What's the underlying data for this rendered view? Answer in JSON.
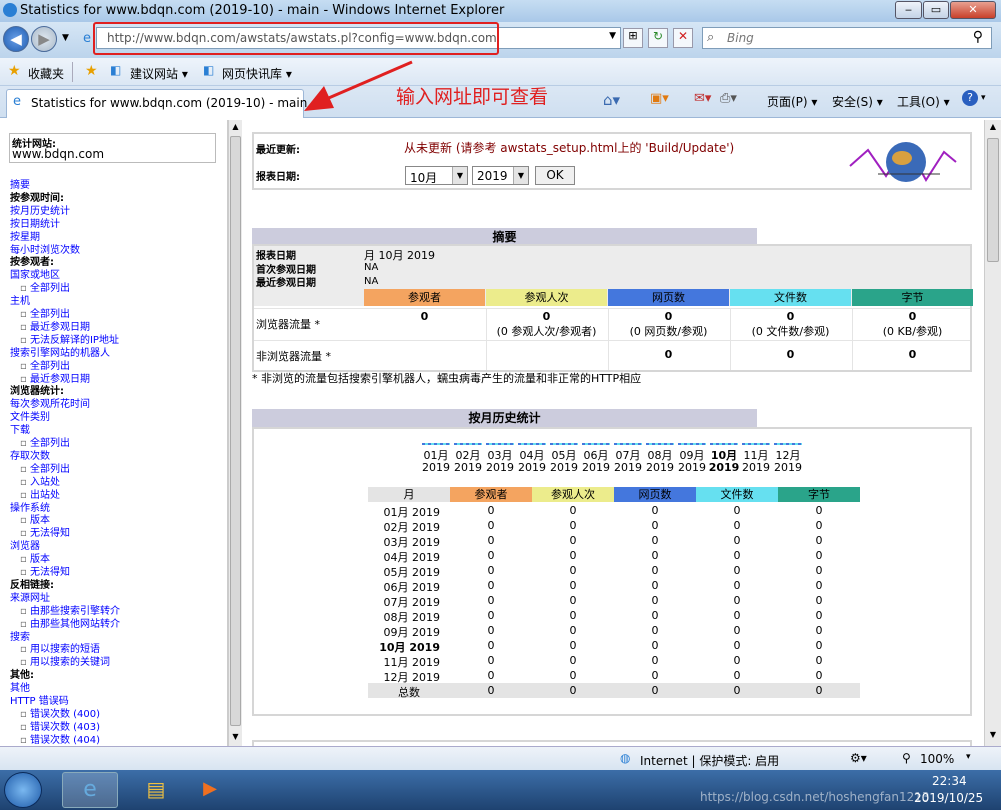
{
  "window": {
    "title": "Statistics for www.bdqn.com (2019-10) - main - Windows Internet Explorer"
  },
  "address": {
    "url": "http://www.bdqn.com/awstats/awstats.pl?config=www.bdqn.com"
  },
  "search": {
    "placeholder": "Bing"
  },
  "favorites": {
    "label": "收藏夹",
    "items": [
      "建议网站 ▾",
      "网页快讯库 ▾"
    ]
  },
  "tab": {
    "label": "Statistics for www.bdqn.com (2019-10) - main"
  },
  "annotation": {
    "text": "输入网址即可查看"
  },
  "commandbar": {
    "page": "页面(P) ▾",
    "safety": "安全(S) ▾",
    "tools": "工具(O) ▾"
  },
  "colors": {
    "visitors": "#f4a460",
    "visits": "#ecec8c",
    "pages": "#4477dd",
    "files": "#66e0f0",
    "bytes": "#2aa48a",
    "annotation": "#e02020"
  },
  "sidebar": {
    "site_label": "统计网站:",
    "site_value": "www.bdqn.com",
    "items": [
      {
        "t": "摘要",
        "k": "link"
      },
      {
        "t": "按参观时间:",
        "k": "bold"
      },
      {
        "t": "按月历史统计",
        "k": "link"
      },
      {
        "t": "按日期统计",
        "k": "link"
      },
      {
        "t": "按星期",
        "k": "link"
      },
      {
        "t": "每小时浏览次数",
        "k": "link"
      },
      {
        "t": "按参观者:",
        "k": "bold"
      },
      {
        "t": "国家或地区",
        "k": "link"
      },
      {
        "t": "全部列出",
        "k": "sub"
      },
      {
        "t": "主机",
        "k": "link"
      },
      {
        "t": "全部列出",
        "k": "sub"
      },
      {
        "t": "最近参观日期",
        "k": "sub"
      },
      {
        "t": "无法反解译的IP地址",
        "k": "sub"
      },
      {
        "t": "搜索引擎网站的机器人",
        "k": "link"
      },
      {
        "t": "全部列出",
        "k": "sub"
      },
      {
        "t": "最近参观日期",
        "k": "sub"
      },
      {
        "t": "浏览器统计:",
        "k": "bold"
      },
      {
        "t": "每次参观所花时间",
        "k": "link"
      },
      {
        "t": "文件类别",
        "k": "link"
      },
      {
        "t": "下载",
        "k": "link"
      },
      {
        "t": "全部列出",
        "k": "sub"
      },
      {
        "t": "存取次数",
        "k": "link"
      },
      {
        "t": "全部列出",
        "k": "sub"
      },
      {
        "t": "入站处",
        "k": "sub"
      },
      {
        "t": "出站处",
        "k": "sub"
      },
      {
        "t": "操作系统",
        "k": "link"
      },
      {
        "t": "版本",
        "k": "sub"
      },
      {
        "t": "无法得知",
        "k": "sub"
      },
      {
        "t": "浏览器",
        "k": "link"
      },
      {
        "t": "版本",
        "k": "sub"
      },
      {
        "t": "无法得知",
        "k": "sub"
      },
      {
        "t": "反相链接:",
        "k": "bold"
      },
      {
        "t": "来源网址",
        "k": "link"
      },
      {
        "t": "由那些搜索引擎转介",
        "k": "sub"
      },
      {
        "t": "由那些其他网站转介",
        "k": "sub"
      },
      {
        "t": "搜索",
        "k": "link"
      },
      {
        "t": "用以搜索的短语",
        "k": "sub"
      },
      {
        "t": "用以搜索的关键词",
        "k": "sub"
      },
      {
        "t": "其他:",
        "k": "bold"
      },
      {
        "t": "其他",
        "k": "link"
      },
      {
        "t": "HTTP 错误码",
        "k": "link"
      },
      {
        "t": "错误次数 (400)",
        "k": "sub"
      },
      {
        "t": "错误次数 (403)",
        "k": "sub"
      },
      {
        "t": "错误次数 (404)",
        "k": "sub"
      }
    ]
  },
  "header": {
    "update_label": "最近更新:",
    "update_value": "从未更新 (请参考 awstats_setup.html上的 'Build/Update')",
    "date_label": "报表日期:",
    "month": "10月",
    "year": "2019",
    "ok": "OK"
  },
  "summary": {
    "title": "摘要",
    "rows": [
      [
        "报表日期",
        "月 10月 2019"
      ],
      [
        "首次参观日期",
        "NA"
      ],
      [
        "最近参观日期",
        "NA"
      ]
    ],
    "cols": [
      "参观者",
      "参观人次",
      "网页数",
      "文件数",
      "字节"
    ],
    "browser_label": "浏览器流量 *",
    "browser_vals": [
      "0",
      "0",
      "0",
      "0",
      "0"
    ],
    "browser_subs": [
      "",
      "(0 参观人次/参观者)",
      "(0 网页数/参观)",
      "(0 文件数/参观)",
      "(0 KB/参观)"
    ],
    "nonbrowser_label": "非浏览器流量 *",
    "nonbrowser_vals": [
      "",
      "",
      "0",
      "0",
      "0"
    ],
    "footnote": "* 非浏览的流量包括搜索引擎机器人，蠕虫病毒产生的流量和非正常的HTTP相应"
  },
  "monthly": {
    "title": "按月历史统计",
    "months": [
      "01月",
      "02月",
      "03月",
      "04月",
      "05月",
      "06月",
      "07月",
      "08月",
      "09月",
      "10月",
      "11月",
      "12月"
    ],
    "year": "2019",
    "cols": [
      "月",
      "参观者",
      "参观人次",
      "网页数",
      "文件数",
      "字节"
    ],
    "rows": [
      [
        "01月 2019",
        "0",
        "0",
        "0",
        "0",
        "0"
      ],
      [
        "02月 2019",
        "0",
        "0",
        "0",
        "0",
        "0"
      ],
      [
        "03月 2019",
        "0",
        "0",
        "0",
        "0",
        "0"
      ],
      [
        "04月 2019",
        "0",
        "0",
        "0",
        "0",
        "0"
      ],
      [
        "05月 2019",
        "0",
        "0",
        "0",
        "0",
        "0"
      ],
      [
        "06月 2019",
        "0",
        "0",
        "0",
        "0",
        "0"
      ],
      [
        "07月 2019",
        "0",
        "0",
        "0",
        "0",
        "0"
      ],
      [
        "08月 2019",
        "0",
        "0",
        "0",
        "0",
        "0"
      ],
      [
        "09月 2019",
        "0",
        "0",
        "0",
        "0",
        "0"
      ],
      [
        "10月 2019",
        "0",
        "0",
        "0",
        "0",
        "0"
      ],
      [
        "11月 2019",
        "0",
        "0",
        "0",
        "0",
        "0"
      ],
      [
        "12月 2019",
        "0",
        "0",
        "0",
        "0",
        "0"
      ],
      [
        "总数",
        "0",
        "0",
        "0",
        "0",
        "0"
      ]
    ]
  },
  "status": {
    "zone": "Internet | 保护模式: 启用",
    "zoom": "100%"
  },
  "taskbar": {
    "time": "22:34",
    "date": "2019/10/25",
    "watermark": "https://blog.csdn.net/hoshengfan1213"
  }
}
